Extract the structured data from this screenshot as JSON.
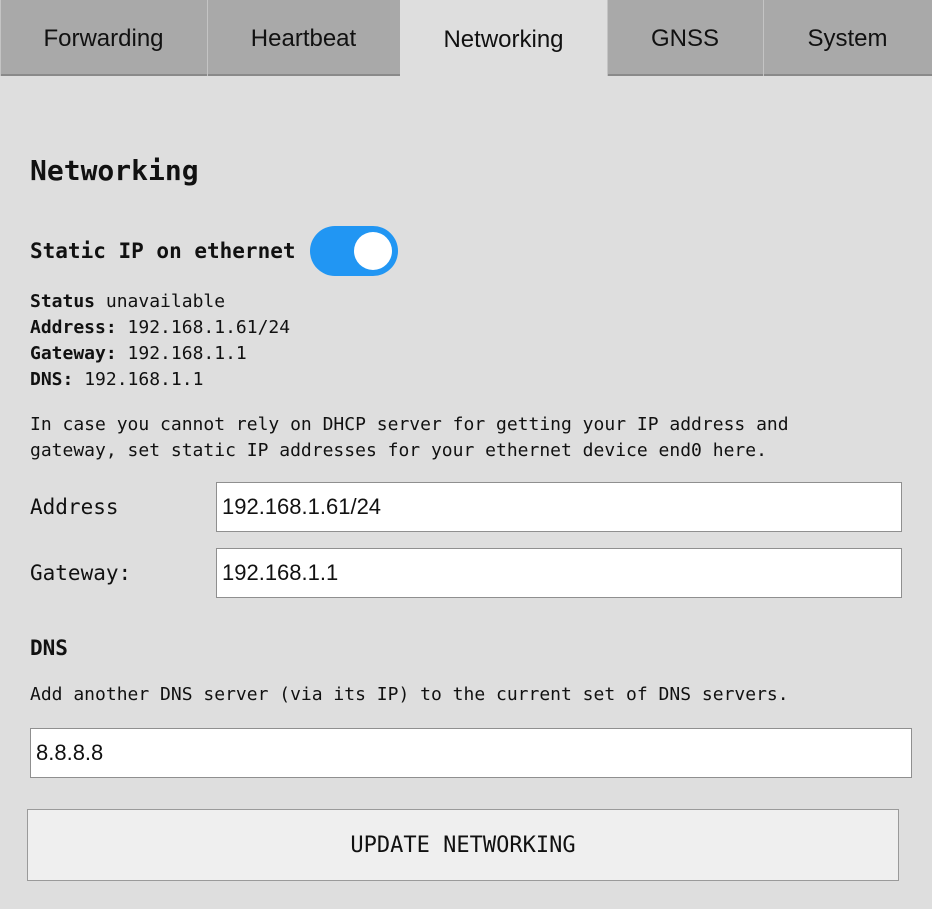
{
  "tabs": [
    {
      "label": "Forwarding",
      "active": false
    },
    {
      "label": "Heartbeat",
      "active": false
    },
    {
      "label": "Networking",
      "active": true
    },
    {
      "label": "GNSS",
      "active": false
    },
    {
      "label": "System",
      "active": false
    }
  ],
  "section": {
    "title": "Networking",
    "static_ip_label": "Static IP on ethernet",
    "static_ip_enabled": true,
    "toggle_color": "#2196f3"
  },
  "status_info": {
    "status_key": "Status",
    "status_value": "unavailable",
    "address_key": "Address:",
    "address_value": "192.168.1.61/24",
    "gateway_key": "Gateway:",
    "gateway_value": "192.168.1.1",
    "dns_key": "DNS:",
    "dns_value": "192.168.1.1"
  },
  "description": "In case you cannot rely on DHCP server for getting your IP address and\ngateway, set static IP addresses for your ethernet device end0 here.",
  "form": {
    "address_label": "Address",
    "address_value": "192.168.1.61/24",
    "gateway_label": "Gateway:",
    "gateway_value": "192.168.1.1"
  },
  "dns": {
    "title": "DNS",
    "description": "Add another DNS server (via its IP) to the current set of DNS servers.",
    "value": "8.8.8.8"
  },
  "update_button_label": "UPDATE NETWORKING"
}
